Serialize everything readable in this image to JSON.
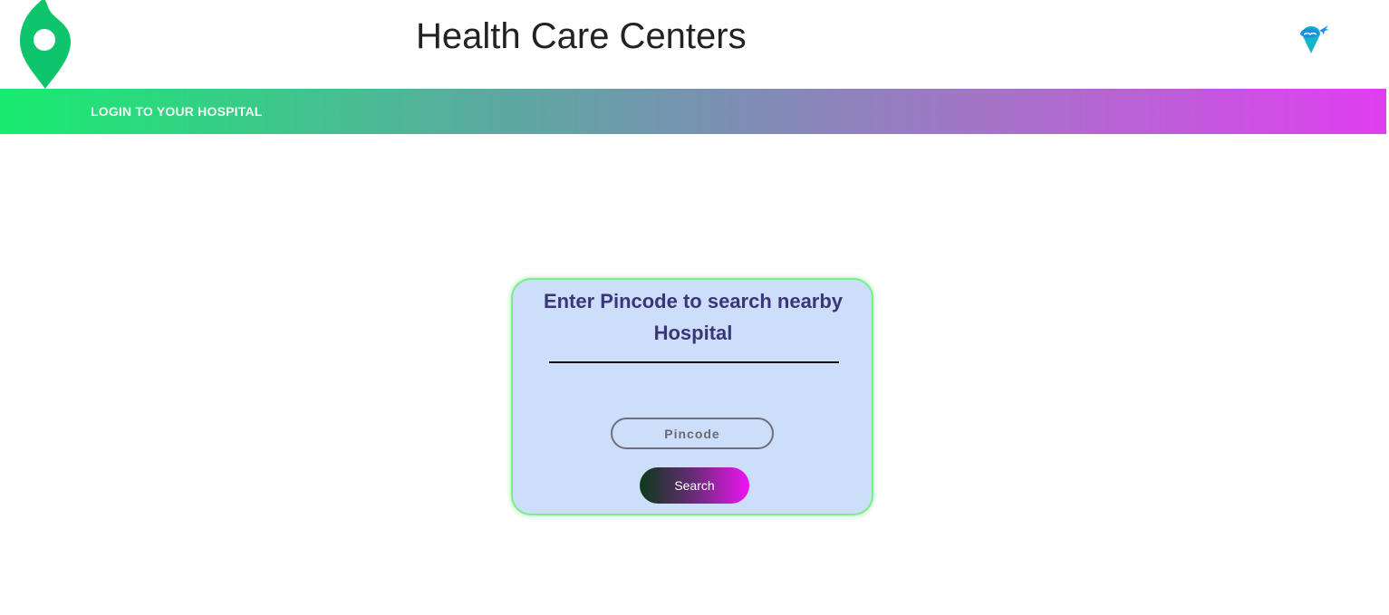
{
  "header": {
    "title": "Health Care Centers",
    "logo_icon": "map-pin-icon",
    "logo_color": "#0fc56b",
    "right_icon": "travel-plane-icon"
  },
  "nav": {
    "login_link": "LOGIN TO YOUR HOSPITAL",
    "gradient_start": "#18ec70",
    "gradient_end": "#e03ff0"
  },
  "search_card": {
    "heading": "Enter Pincode to search nearby Hospital",
    "pincode_placeholder": "Pincode",
    "pincode_value": "",
    "search_button_label": "Search",
    "background_color": "#cddefa",
    "border_color": "#7ded8a",
    "heading_color": "#3a3677"
  }
}
